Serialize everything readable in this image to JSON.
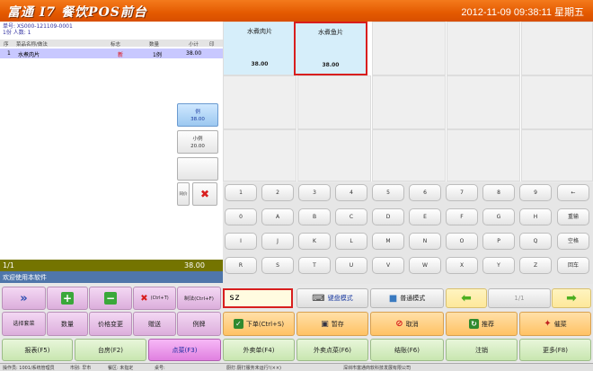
{
  "header": {
    "title": "富通 I7 餐饮POS前台",
    "datetime": "2012-11-09 09:38:11 星期五"
  },
  "order": {
    "number_line": "单号: XS000-121109-0001",
    "count_line": "1份 人数: 1",
    "columns": [
      "序",
      "菜品名称/做法",
      "标志",
      "数量",
      "小计",
      "印"
    ],
    "rows": [
      {
        "no": "1",
        "name": "水煮肉片",
        "flag": "新",
        "qty": "1例",
        "subtotal": "38.00"
      }
    ],
    "page": "1/1",
    "total": "38.00",
    "welcome": "欢迎使用本软件"
  },
  "portions": [
    {
      "name": "例",
      "price": "38.00",
      "selected": true
    },
    {
      "name": "小例",
      "price": "20.00",
      "selected": false
    },
    {
      "name": "",
      "price": "",
      "selected": false
    }
  ],
  "portion_controls": {
    "reset": "同价"
  },
  "dishes": [
    {
      "name": "水煮肉片",
      "price": "38.00",
      "selected": false
    },
    {
      "name": "水煮鱼片",
      "price": "38.00",
      "selected": true
    }
  ],
  "keyboard": {
    "rows": [
      [
        "1",
        "2",
        "3",
        "4",
        "5",
        "6",
        "7",
        "8",
        "9",
        "←"
      ],
      [
        "0",
        "A",
        "B",
        "C",
        "D",
        "E",
        "F",
        "G",
        "H",
        "重输"
      ],
      [
        "I",
        "J",
        "K",
        "L",
        "M",
        "N",
        "O",
        "P",
        "Q",
        "空格"
      ],
      [
        "R",
        "S",
        "T",
        "U",
        "V",
        "W",
        "X",
        "Y",
        "Z",
        "回车"
      ]
    ]
  },
  "actions": {
    "ctrl_t": "(Ctrl+T)",
    "zhifa": "制法(Ctrl+F)",
    "search_value": "sz",
    "keyboard_mode": "键盘模式",
    "normal_mode": "普通模式",
    "pager": "1/1",
    "row2": [
      "选择套菜",
      "数量",
      "价格变更",
      "赠送",
      "例牌"
    ],
    "order_btn": "下单(Ctrl+S)",
    "hold": "暂存",
    "cancel": "取消",
    "recommend": "推荐",
    "urge": "催菜",
    "bottom": [
      "报表(F5)",
      "台房(F2)",
      "点菜(F3)",
      "外卖单(F4)",
      "外卖点菜(F6)",
      "结账(F6)",
      "注销",
      "更多(F8)"
    ]
  },
  "status": {
    "operator": "操作员: 1001/系统管理员",
    "market": "市别: 早市",
    "area": "餐区: 未指定",
    "table": "桌号:",
    "kitchen": "厨打:厨打服务未运行!(××)",
    "company": "深圳市富通商软科技发展有限公司"
  }
}
